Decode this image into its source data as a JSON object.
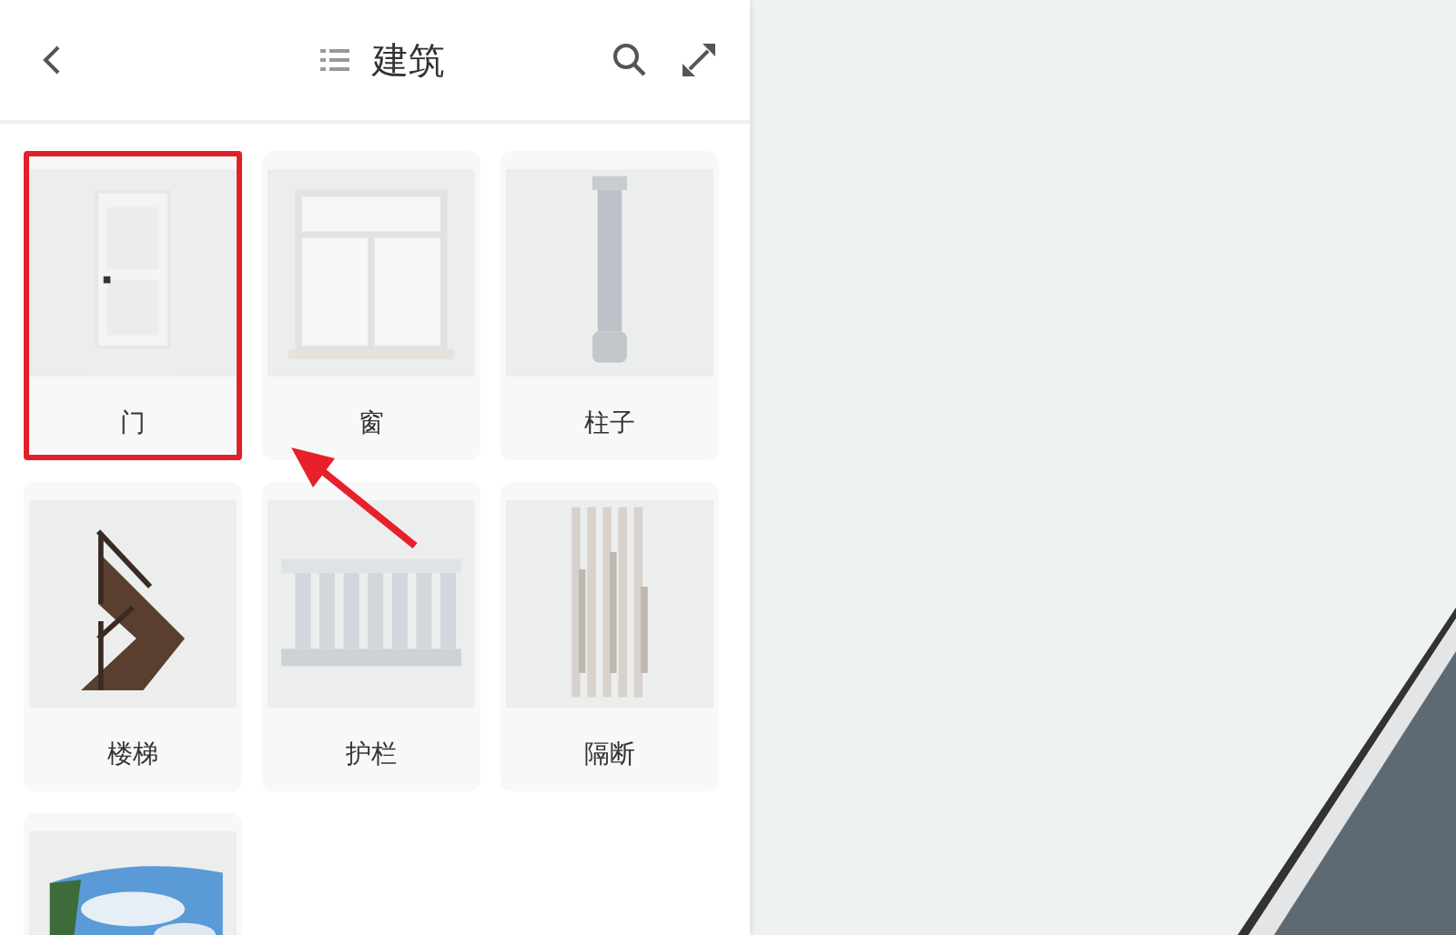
{
  "panel": {
    "title": "建筑"
  },
  "items": [
    {
      "label": "门",
      "selected": true
    },
    {
      "label": "窗",
      "selected": false
    },
    {
      "label": "柱子",
      "selected": false
    },
    {
      "label": "楼梯",
      "selected": false
    },
    {
      "label": "护栏",
      "selected": false
    },
    {
      "label": "隔断",
      "selected": false
    },
    {
      "selected": false
    }
  ]
}
